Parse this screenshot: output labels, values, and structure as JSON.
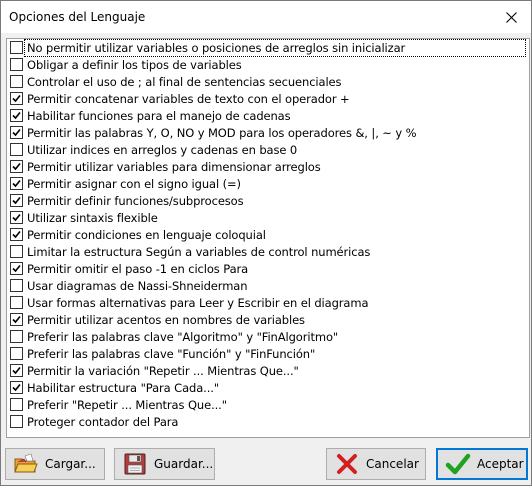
{
  "window": {
    "title": "Opciones del Lenguaje"
  },
  "options": [
    {
      "label": "No permitir utilizar variables o posiciones de arreglos sin inicializar",
      "checked": false
    },
    {
      "label": "Obligar a definir los tipos de variables",
      "checked": false
    },
    {
      "label": "Controlar el uso de ; al final de sentencias secuenciales",
      "checked": false
    },
    {
      "label": "Permitir concatenar variables de texto con el operador +",
      "checked": true
    },
    {
      "label": "Habilitar funciones para el manejo de cadenas",
      "checked": true
    },
    {
      "label": "Permitir las palabras Y, O, NO y MOD para los operadores &, |, ~ y %",
      "checked": true
    },
    {
      "label": "Utilizar indices en arreglos y cadenas en base 0",
      "checked": false
    },
    {
      "label": "Permitir utilizar variables para dimensionar arreglos",
      "checked": true
    },
    {
      "label": "Permitir asignar con el signo igual (=)",
      "checked": true
    },
    {
      "label": "Permitir definir funciones/subprocesos",
      "checked": true
    },
    {
      "label": "Utilizar sintaxis flexible",
      "checked": true
    },
    {
      "label": "Permitir condiciones en lenguaje coloquial",
      "checked": true
    },
    {
      "label": "Limitar la estructura Según a variables de control numéricas",
      "checked": false
    },
    {
      "label": "Permitir omitir el paso -1 en ciclos Para",
      "checked": true
    },
    {
      "label": "Usar diagramas de Nassi-Shneiderman",
      "checked": false
    },
    {
      "label": "Usar formas alternativas para Leer y Escribir en el diagrama",
      "checked": false
    },
    {
      "label": "Permitir utilizar acentos en nombres de variables",
      "checked": true
    },
    {
      "label": "Preferir las palabras clave \"Algoritmo\" y \"FinAlgoritmo\"",
      "checked": false
    },
    {
      "label": "Preferir las palabras clave \"Función\" y \"FinFunción\"",
      "checked": false
    },
    {
      "label": "Permitir la variación \"Repetir ... Mientras Que...\"",
      "checked": true
    },
    {
      "label": "Habilitar estructura \"Para Cada...\"",
      "checked": true
    },
    {
      "label": "Preferir \"Repetir ... Mientras Que...\"",
      "checked": false
    },
    {
      "label": "Proteger contador del Para",
      "checked": false
    }
  ],
  "buttons": {
    "cargar": "Cargar...",
    "guardar": "Guardar...",
    "cancelar": "Cancelar",
    "aceptar": "Aceptar"
  },
  "icons": {
    "close": "close-icon",
    "cargar": "folder-open-icon",
    "guardar": "floppy-disk-icon",
    "cancelar": "red-x-icon",
    "aceptar": "green-check-icon"
  },
  "colors": {
    "accent": "#0078d7",
    "cancel_red": "#d21f1f",
    "accept_green": "#1fa31f"
  }
}
